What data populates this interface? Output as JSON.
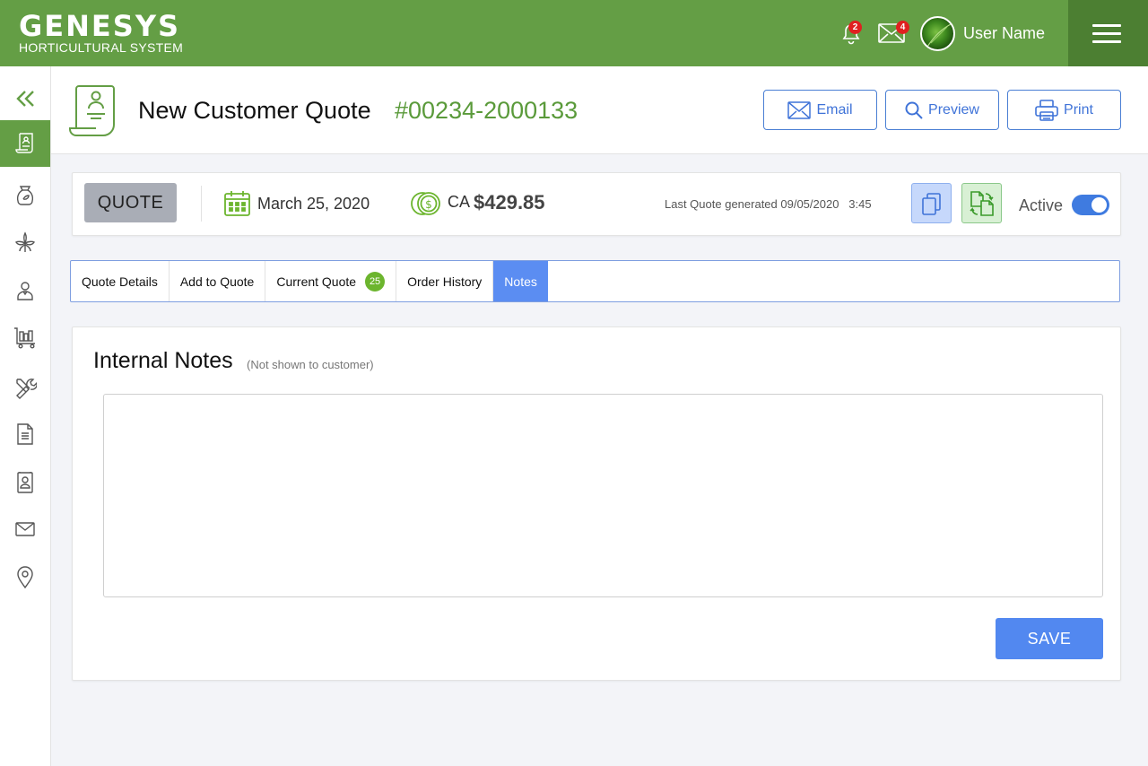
{
  "app": {
    "brand": "GENESYS",
    "subtitle": "HORTICULTURAL SYSTEM",
    "notifications_count": "2",
    "messages_count": "4",
    "user_name": "User Name"
  },
  "sidebar": {
    "items": [
      {
        "icon": "double-chevron-left-icon"
      },
      {
        "icon": "quote-scroll-icon",
        "active": true
      },
      {
        "icon": "seed-bag-icon"
      },
      {
        "icon": "plant-icon"
      },
      {
        "icon": "customer-icon"
      },
      {
        "icon": "cart-icon"
      },
      {
        "icon": "tools-icon"
      },
      {
        "icon": "document-icon"
      },
      {
        "icon": "contact-book-icon"
      },
      {
        "icon": "mail-icon"
      },
      {
        "icon": "location-pin-icon"
      }
    ]
  },
  "header": {
    "title": "New Customer Quote",
    "quote_number": "#00234-2000133",
    "buttons": {
      "email": "Email",
      "preview": "Preview",
      "print": "Print"
    }
  },
  "summary": {
    "status": "QUOTE",
    "date": "March 25, 2020",
    "currency": "CA",
    "amount": "$429.85",
    "last_generated": "Last Quote generated 09/05/2020   3:45",
    "active_label": "Active",
    "active": true
  },
  "tabs": [
    {
      "label": "Quote Details"
    },
    {
      "label": "Add to Quote"
    },
    {
      "label": "Current Quote",
      "badge": "25"
    },
    {
      "label": "Order History"
    },
    {
      "label": "Notes",
      "active": true
    }
  ],
  "notes": {
    "title": "Internal Notes",
    "subtitle": "(Not shown to customer)",
    "value": "",
    "save_label": "SAVE"
  },
  "colors": {
    "brand_green": "#649e45",
    "dark_green": "#4c7f32",
    "accent_blue": "#5b8df2",
    "quote_number_green": "#5a9a3a"
  }
}
